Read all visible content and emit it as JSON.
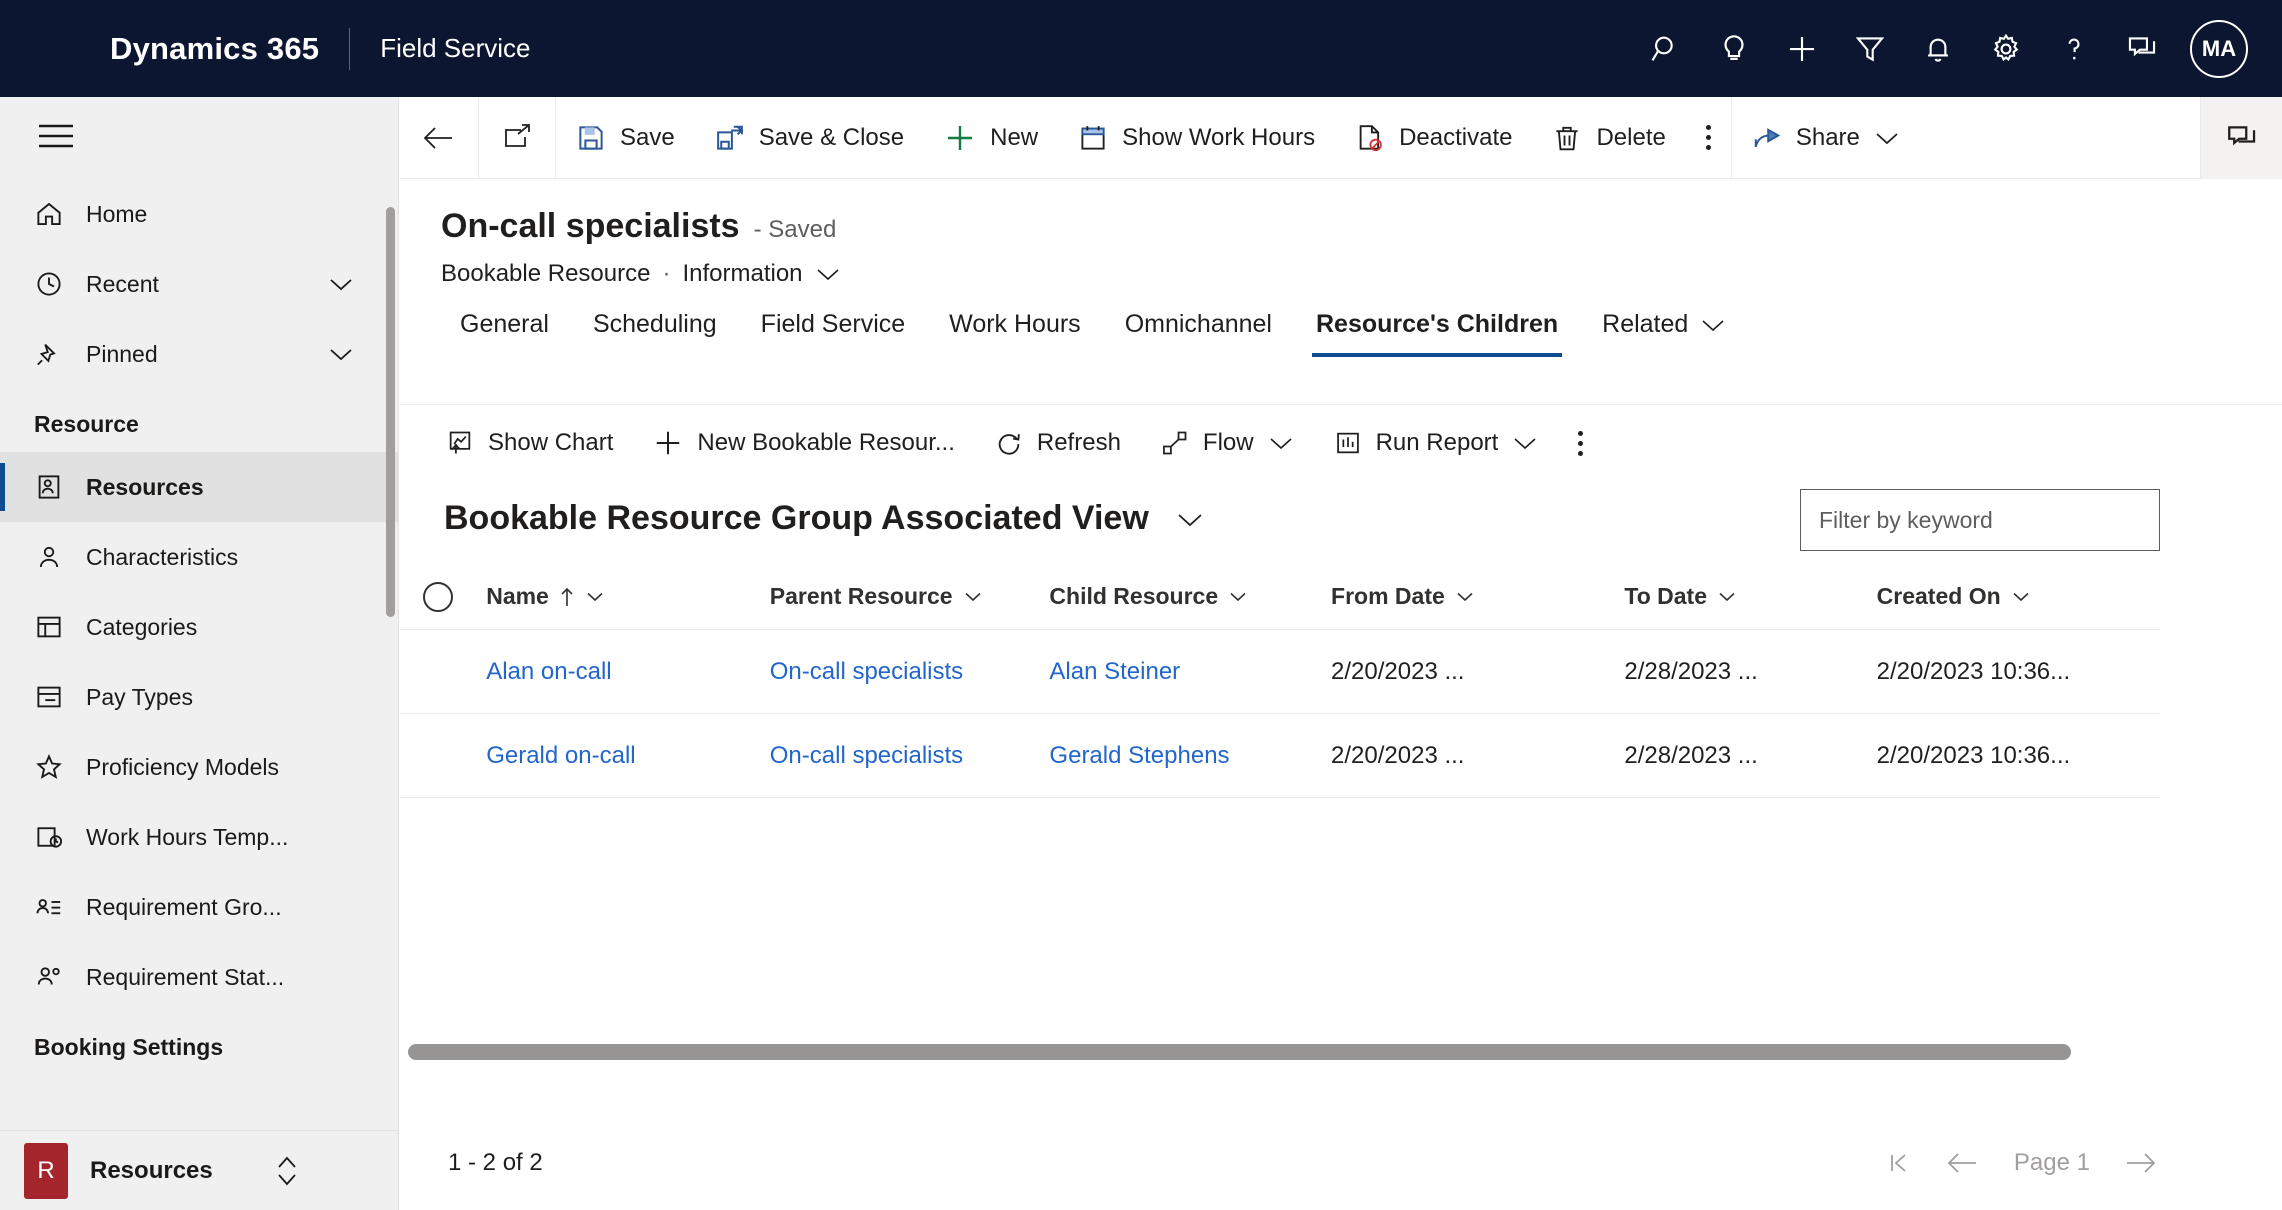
{
  "topnav": {
    "brand": "Dynamics 365",
    "app_name": "Field Service",
    "icons": [
      {
        "name": "search-icon",
        "label": "Search"
      },
      {
        "name": "lightbulb-icon",
        "label": "Copilot"
      },
      {
        "name": "plus-icon",
        "label": "Quick create"
      },
      {
        "name": "filter-icon",
        "label": "Filter"
      },
      {
        "name": "bell-icon",
        "label": "Notifications"
      },
      {
        "name": "gear-icon",
        "label": "Settings"
      },
      {
        "name": "question-icon",
        "label": "Help"
      },
      {
        "name": "feedback-icon",
        "label": "Feedback"
      }
    ],
    "avatar_initials": "MA"
  },
  "sidebar": {
    "hamburger_label": "Site map",
    "items": [
      {
        "label": "Home",
        "icon": "home-icon",
        "selected": false,
        "chevron": false
      },
      {
        "label": "Recent",
        "icon": "clock-icon",
        "selected": false,
        "chevron": true
      },
      {
        "label": "Pinned",
        "icon": "pin-icon",
        "selected": false,
        "chevron": true
      }
    ],
    "group_resource": "Resource",
    "resource_items": [
      {
        "label": "Resources",
        "icon": "resource-icon",
        "selected": true
      },
      {
        "label": "Characteristics",
        "icon": "person-icon",
        "selected": false
      },
      {
        "label": "Categories",
        "icon": "category-icon",
        "selected": false
      },
      {
        "label": "Pay Types",
        "icon": "paytype-icon",
        "selected": false
      },
      {
        "label": "Proficiency Models",
        "icon": "star-icon",
        "selected": false
      },
      {
        "label": "Work Hours Temp...",
        "icon": "workhours-icon",
        "selected": false
      },
      {
        "label": "Requirement Gro...",
        "icon": "requirement-group-icon",
        "selected": false
      },
      {
        "label": "Requirement Stat...",
        "icon": "requirement-status-icon",
        "selected": false
      }
    ],
    "group_booking": "Booking Settings",
    "area_badge": "R",
    "area_label": "Resources"
  },
  "commandbar": {
    "back_label": "Back",
    "popout_label": "Open in new window",
    "buttons": [
      {
        "label": "Save",
        "icon": "save-icon"
      },
      {
        "label": "Save & Close",
        "icon": "save-close-icon"
      },
      {
        "label": "New",
        "icon": "plus-icon"
      },
      {
        "label": "Show Work Hours",
        "icon": "calendar-icon"
      },
      {
        "label": "Deactivate",
        "icon": "deactivate-icon"
      },
      {
        "label": "Delete",
        "icon": "trash-icon"
      }
    ],
    "overflow_label": "More commands",
    "share_label": "Share",
    "panel_label": "Open side panel"
  },
  "form": {
    "record_title": "On-call specialists",
    "saved_status": "- Saved",
    "entity_name": "Bookable Resource",
    "separator": "·",
    "form_name": "Information",
    "tabs": [
      {
        "label": "General",
        "active": false
      },
      {
        "label": "Scheduling",
        "active": false
      },
      {
        "label": "Field Service",
        "active": false
      },
      {
        "label": "Work Hours",
        "active": false
      },
      {
        "label": "Omnichannel",
        "active": false
      },
      {
        "label": "Resource's Children",
        "active": true
      },
      {
        "label": "Related",
        "active": false
      }
    ]
  },
  "subgrid": {
    "buttons": [
      {
        "label": "Show Chart",
        "icon": "chart-icon"
      },
      {
        "label": "New Bookable Resour...",
        "icon": "plus-icon"
      },
      {
        "label": "Refresh",
        "icon": "refresh-icon"
      },
      {
        "label": "Flow",
        "icon": "flow-icon",
        "chevron": true
      },
      {
        "label": "Run Report",
        "icon": "report-icon",
        "chevron": true
      }
    ],
    "overflow_label": "More commands",
    "view_name": "Bookable Resource Group Associated View",
    "filter_placeholder": "Filter by keyword",
    "columns": [
      {
        "label": "Name",
        "sort": "asc",
        "key": "name"
      },
      {
        "label": "Parent Resource",
        "sort": "",
        "key": "parent"
      },
      {
        "label": "Child Resource",
        "sort": "",
        "key": "child"
      },
      {
        "label": "From Date",
        "sort": "",
        "key": "from"
      },
      {
        "label": "To Date",
        "sort": "",
        "key": "to"
      },
      {
        "label": "Created On",
        "sort": "",
        "key": "created"
      }
    ],
    "rows": [
      {
        "name": "Alan on-call",
        "parent": "On-call specialists",
        "child": "Alan Steiner",
        "from": "2/20/2023 ...",
        "to": "2/28/2023 ...",
        "created": "2/20/2023 10:36..."
      },
      {
        "name": "Gerald on-call",
        "parent": "On-call specialists",
        "child": "Gerald Stephens",
        "from": "2/20/2023 ...",
        "to": "2/28/2023 ...",
        "created": "2/20/2023 10:36..."
      }
    ]
  },
  "footer": {
    "record_count": "1 - 2 of 2",
    "page_label": "Page 1",
    "first_page_label": "First page",
    "prev_page_label": "Previous page",
    "next_page_label": "Next page"
  },
  "colors": {
    "navbar": "#0d1631",
    "accent": "#0f4b8f",
    "link": "#2266cc",
    "sidebar": "#f0f0f0",
    "area_badge": "#a4262c"
  }
}
